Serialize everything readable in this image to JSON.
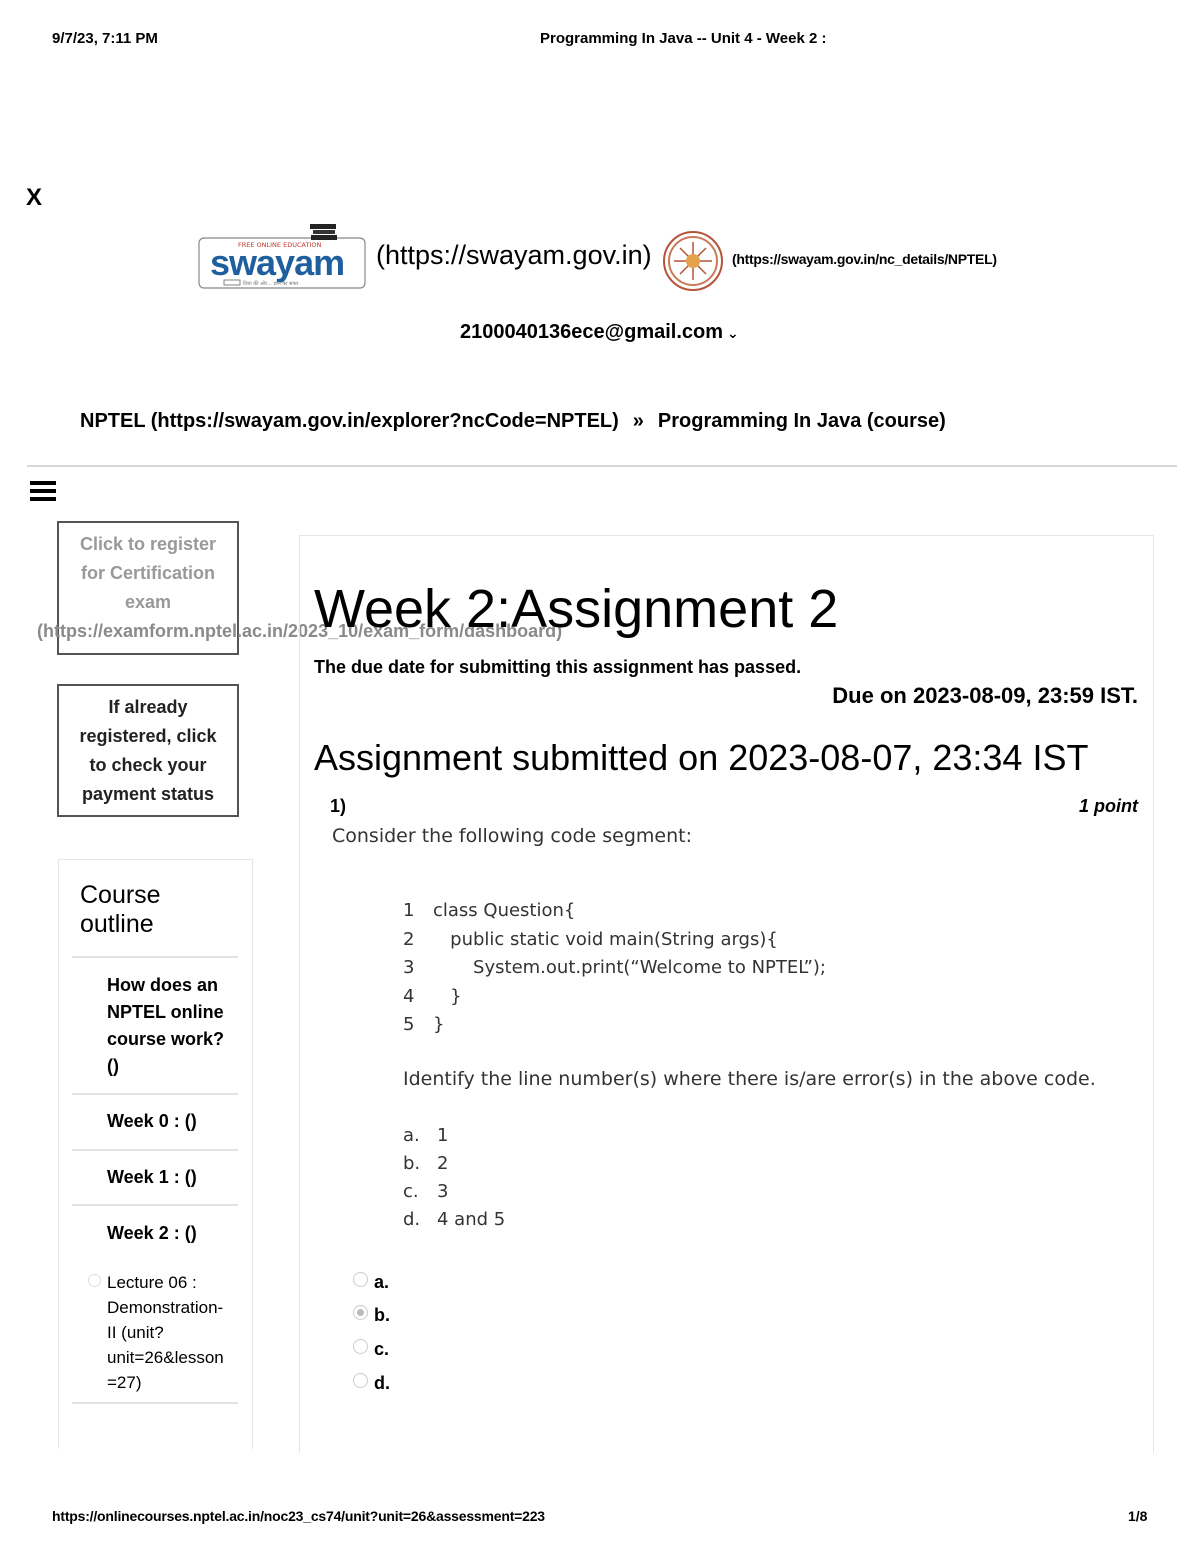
{
  "print_header": {
    "datetime": "9/7/23, 7:11 PM",
    "title": "Programming In Java -- Unit 4 - Week 2 :"
  },
  "close_label": "X",
  "header": {
    "swayam_link": "(https://swayam.gov.in)",
    "nptel_link": "(https://swayam.gov.in/nc_details/NPTEL)",
    "user_email": "2100040136ece@gmail.com",
    "swayam_logo_top": "FREE ONLINE EDUCATION",
    "swayam_logo_word": "swayam",
    "swayam_logo_tagline": "दिशा की ओर... ज्ञान का सफर"
  },
  "breadcrumb": {
    "root": "NPTEL (https://swayam.gov.in/explorer?ncCode=NPTEL)",
    "separator": "»",
    "current": "Programming In Java (course)"
  },
  "sidebar": {
    "register": {
      "lines": [
        "Click to register",
        "for Certification",
        "exam"
      ],
      "url": "(https://examform.nptel.ac.in/2023_10/exam_form/dashboard)"
    },
    "payment_status": {
      "lines": [
        "If already",
        "registered, click",
        "to check your",
        "payment status"
      ]
    },
    "outline_title_lines": [
      "Course",
      "outline"
    ],
    "outline_items": [
      {
        "lines": [
          "How does an",
          "NPTEL online",
          "course work?",
          "()"
        ]
      },
      {
        "lines": [
          "Week 0 : ()"
        ]
      },
      {
        "lines": [
          "Week 1 : ()"
        ]
      },
      {
        "lines": [
          "Week 2 : ()"
        ]
      }
    ],
    "lecture_lines": [
      "Lecture 06 :",
      "Demonstration-",
      "II (unit?",
      "unit=26&lesson",
      "=27)"
    ]
  },
  "assignment": {
    "title": "Week 2:Assignment 2",
    "due_passed": "The due date for submitting this assignment has passed.",
    "due_on": "Due on 2023-08-09, 23:59 IST.",
    "submitted_on": "Assignment submitted on 2023-08-07, 23:34 IST"
  },
  "question1": {
    "number": "1)",
    "points": "1 point",
    "prompt": "Consider the following code segment:",
    "code_lines": [
      {
        "num": "1",
        "text": "class Question{"
      },
      {
        "num": "2",
        "text": "   public static void main(String args){"
      },
      {
        "num": "3",
        "text": "       System.out.print(“Welcome to NPTEL”);"
      },
      {
        "num": "4",
        "text": "   }"
      },
      {
        "num": "5",
        "text": "}"
      }
    ],
    "identify": "Identify the line number(s) where there is/are error(s) in the above code.",
    "options": [
      {
        "label": "a.",
        "text": "1"
      },
      {
        "label": "b.",
        "text": "2"
      },
      {
        "label": "c.",
        "text": "3"
      },
      {
        "label": "d.",
        "text": "4 and 5"
      }
    ],
    "answers": [
      {
        "label": "a.",
        "selected": false
      },
      {
        "label": "b.",
        "selected": true
      },
      {
        "label": "c.",
        "selected": false
      },
      {
        "label": "d.",
        "selected": false
      }
    ]
  },
  "print_footer": {
    "url": "https://onlinecourses.nptel.ac.in/noc23_cs74/unit?unit=26&assessment=223",
    "page": "1/8"
  },
  "colors": {
    "swayam_blue": "#1f5f9e",
    "nptel_ring": "#b5543a",
    "nptel_center": "#e3a24a"
  }
}
